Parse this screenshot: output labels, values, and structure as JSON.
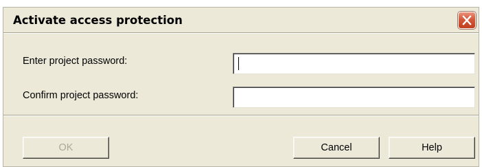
{
  "dialog": {
    "title": "Activate access protection"
  },
  "fields": {
    "password_label": "Enter project password:",
    "password_value": "",
    "confirm_label": "Confirm project password:",
    "confirm_value": ""
  },
  "buttons": {
    "ok_label": "OK",
    "ok_enabled": false,
    "cancel_label": "Cancel",
    "help_label": "Help"
  },
  "icons": {
    "close": "close-icon"
  },
  "colors": {
    "dialog_background": "#ece9d8",
    "close_button": "#d3593a",
    "disabled_text": "#aca899"
  }
}
